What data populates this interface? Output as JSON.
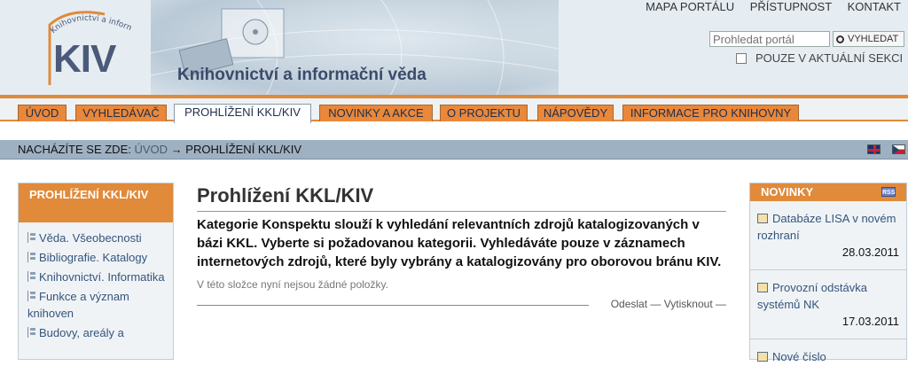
{
  "header": {
    "logo_text": "KIV",
    "logo_arc_text": "Knihovnictví a informační věda",
    "site_title": "Knihovnictví a informační věda",
    "top_links": [
      "MAPA PORTÁLU",
      "PŘÍSTUPNOST",
      "KONTAKT"
    ],
    "search": {
      "placeholder": "Prohledat portál",
      "button_label": "VYHLEDAT"
    },
    "section_only_label": "POUZE V AKTUÁLNÍ SEKCI"
  },
  "nav": {
    "tabs": [
      {
        "label": "ÚVOD"
      },
      {
        "label": "VYHLEDÁVAČ"
      },
      {
        "label": "PROHLÍŽENÍ KKL/KIV",
        "active": true
      },
      {
        "label": "NOVINKY A AKCE"
      },
      {
        "label": "O PROJEKTU"
      },
      {
        "label": "NÁPOVĚDY"
      },
      {
        "label": "INFORMACE PRO KNIHOVNY"
      }
    ]
  },
  "breadcrumb": {
    "prefix": "NACHÁZÍTE SE ZDE:",
    "home": "ÚVOD",
    "arrow": "→",
    "current": "PROHLÍŽENÍ KKL/KIV"
  },
  "left_portlet": {
    "title": "PROHLÍŽENÍ KKL/KIV",
    "items": [
      "Věda. Všeobecnosti",
      "Bibliografie. Katalogy",
      "Knihovnictví. Informatika",
      "Funkce a význam knihoven",
      "Budovy, areály a"
    ]
  },
  "main": {
    "title": "Prohlížení KKL/KIV",
    "description": "Kategorie Konspektu slouží k vyhledání relevantních zdrojů katalogizovaných v bázi KKL. Vyberte si požadovanou kategorii. Vyhledáváte pouze v záznamech internetových zdrojů, které byly vybrány a katalogizovány pro oborovou bránu KIV.",
    "empty_note": "V této složce nyní nejsou žádné položky.",
    "actions": {
      "send": "Odeslat",
      "print": "Vytisknout",
      "dash": "—"
    }
  },
  "news": {
    "title": "NOVINKY",
    "rss": "RSS",
    "items": [
      {
        "title": "Databáze LISA v novém rozhraní",
        "date": "28.03.2011"
      },
      {
        "title": "Provozní odstávka systémů NK",
        "date": "17.03.2011"
      },
      {
        "title": "Nové číslo",
        "date": ""
      }
    ]
  },
  "colors": {
    "accent_orange": "#e08a3a",
    "breadcrumb_bar": "#9eb1c2",
    "link_blue": "#34557c"
  }
}
